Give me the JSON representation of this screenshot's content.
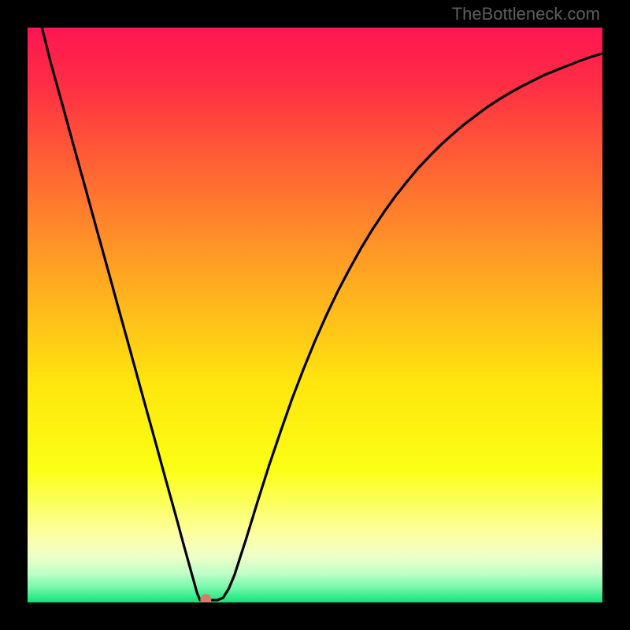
{
  "watermark": "TheBottleneck.com",
  "chart_data": {
    "type": "line",
    "title": "",
    "xlabel": "",
    "ylabel": "",
    "xlim": [
      0,
      1
    ],
    "ylim": [
      0,
      1
    ],
    "series": [
      {
        "name": "curve",
        "x": [
          0.0,
          0.02,
          0.04,
          0.06,
          0.08,
          0.1,
          0.12,
          0.14,
          0.16,
          0.18,
          0.2,
          0.22,
          0.24,
          0.26,
          0.27,
          0.28,
          0.285,
          0.29,
          0.295,
          0.3,
          0.305,
          0.31,
          0.315,
          0.32,
          0.33,
          0.34,
          0.35,
          0.36,
          0.38,
          0.4,
          0.42,
          0.44,
          0.46,
          0.48,
          0.5,
          0.52,
          0.54,
          0.56,
          0.58,
          0.6,
          0.62,
          0.64,
          0.66,
          0.68,
          0.7,
          0.72,
          0.74,
          0.76,
          0.78,
          0.8,
          0.82,
          0.84,
          0.86,
          0.88,
          0.9,
          0.92,
          0.94,
          0.96,
          0.98,
          1.0
        ],
        "y": [
          1.1,
          1.02,
          0.94,
          0.868,
          0.795,
          0.723,
          0.65,
          0.578,
          0.505,
          0.433,
          0.36,
          0.288,
          0.215,
          0.143,
          0.106,
          0.07,
          0.052,
          0.034,
          0.016,
          0.004,
          0.004,
          0.004,
          0.004,
          0.004,
          0.004,
          0.008,
          0.024,
          0.048,
          0.11,
          0.175,
          0.238,
          0.297,
          0.354,
          0.406,
          0.455,
          0.5,
          0.542,
          0.58,
          0.616,
          0.649,
          0.679,
          0.707,
          0.732,
          0.756,
          0.777,
          0.797,
          0.815,
          0.832,
          0.847,
          0.862,
          0.875,
          0.887,
          0.898,
          0.908,
          0.918,
          0.926,
          0.934,
          0.942,
          0.949,
          0.955
        ]
      }
    ],
    "marker": {
      "x": 0.31,
      "y": 0.005,
      "color": "#d67a6c"
    },
    "gradient_stops": [
      {
        "pos": 0.0,
        "color": "#ff1552"
      },
      {
        "pos": 0.1,
        "color": "#ff2e44"
      },
      {
        "pos": 0.25,
        "color": "#ff6633"
      },
      {
        "pos": 0.46,
        "color": "#ffb01f"
      },
      {
        "pos": 0.62,
        "color": "#ffe60d"
      },
      {
        "pos": 0.77,
        "color": "#fbff15"
      },
      {
        "pos": 0.88,
        "color": "#fdffa0"
      },
      {
        "pos": 0.92,
        "color": "#eeffc8"
      },
      {
        "pos": 0.95,
        "color": "#bfffc8"
      },
      {
        "pos": 0.975,
        "color": "#72f7a8"
      },
      {
        "pos": 1.0,
        "color": "#10e37a"
      }
    ]
  }
}
